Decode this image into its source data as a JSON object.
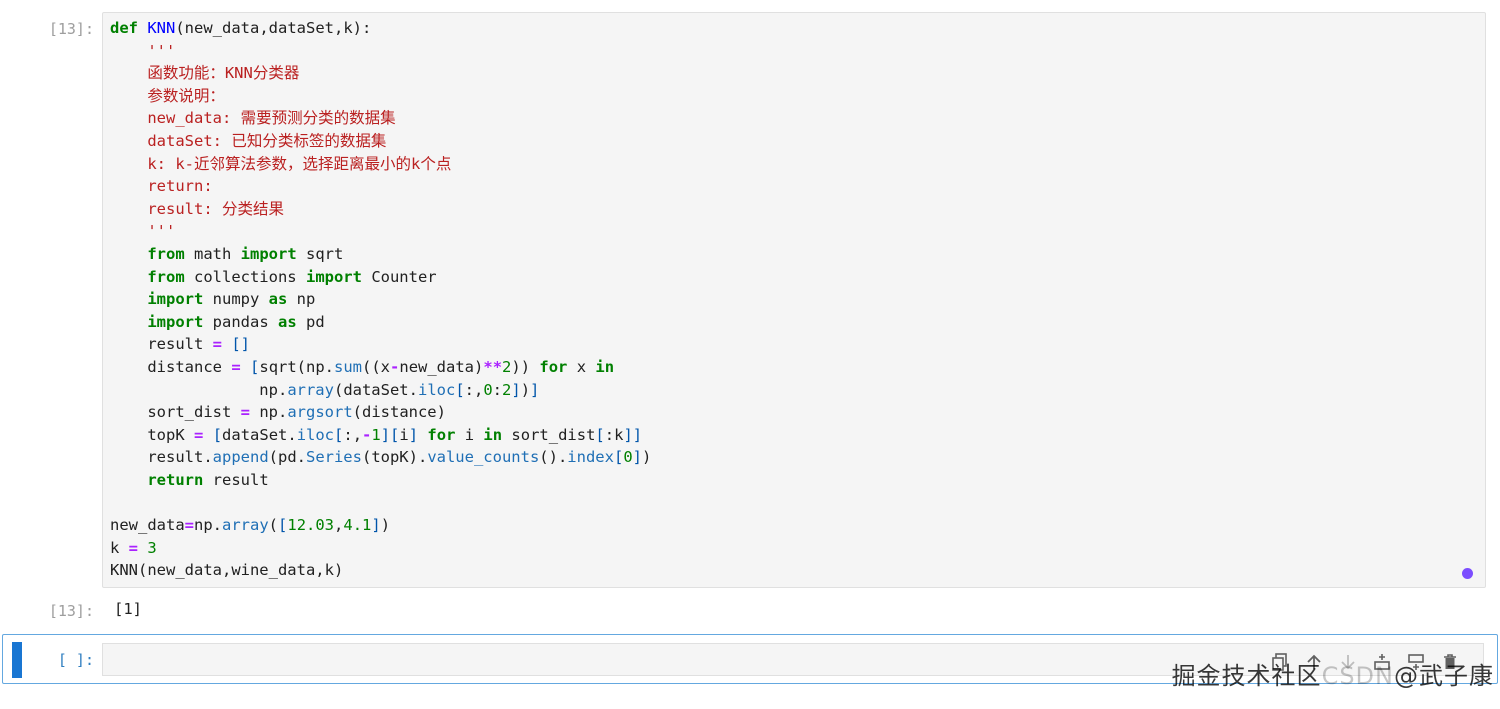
{
  "cells": [
    {
      "prompt": "[13]:",
      "code_lines": [
        [
          [
            "kw",
            "def"
          ],
          [
            "tx",
            " "
          ],
          [
            "fn",
            "KNN"
          ],
          [
            "tx",
            "(new_data,dataSet,k):"
          ]
        ],
        [
          [
            "tx",
            "    "
          ],
          [
            "st",
            "'''"
          ]
        ],
        [
          [
            "tx",
            "    "
          ],
          [
            "st",
            "函数功能：KNN分类器"
          ]
        ],
        [
          [
            "tx",
            "    "
          ],
          [
            "st",
            "参数说明："
          ]
        ],
        [
          [
            "tx",
            "    "
          ],
          [
            "st",
            "new_data: 需要预测分类的数据集"
          ]
        ],
        [
          [
            "tx",
            "    "
          ],
          [
            "st",
            "dataSet: 已知分类标签的数据集"
          ]
        ],
        [
          [
            "tx",
            "    "
          ],
          [
            "st",
            "k: k-近邻算法参数，选择距离最小的k个点"
          ]
        ],
        [
          [
            "tx",
            "    "
          ],
          [
            "st",
            "return:"
          ]
        ],
        [
          [
            "tx",
            "    "
          ],
          [
            "st",
            "result: 分类结果"
          ]
        ],
        [
          [
            "tx",
            "    "
          ],
          [
            "st",
            "'''"
          ]
        ],
        [
          [
            "tx",
            "    "
          ],
          [
            "kw",
            "from"
          ],
          [
            "tx",
            " math "
          ],
          [
            "kw",
            "import"
          ],
          [
            "tx",
            " sqrt"
          ]
        ],
        [
          [
            "tx",
            "    "
          ],
          [
            "kw",
            "from"
          ],
          [
            "tx",
            " collections "
          ],
          [
            "kw",
            "import"
          ],
          [
            "tx",
            " Counter"
          ]
        ],
        [
          [
            "tx",
            "    "
          ],
          [
            "kw",
            "import"
          ],
          [
            "tx",
            " numpy "
          ],
          [
            "kw",
            "as"
          ],
          [
            "tx",
            " np"
          ]
        ],
        [
          [
            "tx",
            "    "
          ],
          [
            "kw",
            "import"
          ],
          [
            "tx",
            " pandas "
          ],
          [
            "kw",
            "as"
          ],
          [
            "tx",
            " pd"
          ]
        ],
        [
          [
            "tx",
            "    result "
          ],
          [
            "op",
            "="
          ],
          [
            "tx",
            " "
          ],
          [
            "br",
            "[]"
          ]
        ],
        [
          [
            "tx",
            "    distance "
          ],
          [
            "op",
            "="
          ],
          [
            "tx",
            " "
          ],
          [
            "br",
            "["
          ],
          [
            "tx",
            "sqrt(np."
          ],
          [
            "at",
            "sum"
          ],
          [
            "tx",
            "((x"
          ],
          [
            "op",
            "-"
          ],
          [
            "tx",
            "new_data)"
          ],
          [
            "op",
            "**"
          ],
          [
            "nu",
            "2"
          ],
          [
            "tx",
            ")) "
          ],
          [
            "kw",
            "for"
          ],
          [
            "tx",
            " x "
          ],
          [
            "kw",
            "in"
          ]
        ],
        [
          [
            "tx",
            "                np."
          ],
          [
            "at",
            "array"
          ],
          [
            "tx",
            "(dataSet."
          ],
          [
            "at",
            "iloc"
          ],
          [
            "br",
            "["
          ],
          [
            "tx",
            ":,"
          ],
          [
            "nu",
            "0"
          ],
          [
            "tx",
            ":"
          ],
          [
            "nu",
            "2"
          ],
          [
            "br",
            "]"
          ],
          [
            "tx",
            ")"
          ],
          [
            "br",
            "]"
          ]
        ],
        [
          [
            "tx",
            "    sort_dist "
          ],
          [
            "op",
            "="
          ],
          [
            "tx",
            " np."
          ],
          [
            "at",
            "argsort"
          ],
          [
            "tx",
            "(distance)"
          ]
        ],
        [
          [
            "tx",
            "    topK "
          ],
          [
            "op",
            "="
          ],
          [
            "tx",
            " "
          ],
          [
            "br",
            "["
          ],
          [
            "tx",
            "dataSet."
          ],
          [
            "at",
            "iloc"
          ],
          [
            "br",
            "["
          ],
          [
            "tx",
            ":,"
          ],
          [
            "op",
            "-"
          ],
          [
            "nu",
            "1"
          ],
          [
            "br",
            "]["
          ],
          [
            "tx",
            "i"
          ],
          [
            "br",
            "]"
          ],
          [
            "tx",
            " "
          ],
          [
            "kw",
            "for"
          ],
          [
            "tx",
            " i "
          ],
          [
            "kw",
            "in"
          ],
          [
            "tx",
            " sort_dist"
          ],
          [
            "br",
            "["
          ],
          [
            "tx",
            ":k"
          ],
          [
            "br",
            "]]"
          ]
        ],
        [
          [
            "tx",
            "    result."
          ],
          [
            "at",
            "append"
          ],
          [
            "tx",
            "(pd."
          ],
          [
            "at",
            "Series"
          ],
          [
            "tx",
            "(topK)."
          ],
          [
            "at",
            "value_counts"
          ],
          [
            "tx",
            "()."
          ],
          [
            "at",
            "index"
          ],
          [
            "br",
            "["
          ],
          [
            "nu",
            "0"
          ],
          [
            "br",
            "]"
          ],
          [
            "tx",
            ")"
          ]
        ],
        [
          [
            "tx",
            "    "
          ],
          [
            "kw",
            "return"
          ],
          [
            "tx",
            " result"
          ]
        ],
        [
          [
            "tx",
            ""
          ]
        ],
        [
          [
            "tx",
            "new_data"
          ],
          [
            "op",
            "="
          ],
          [
            "tx",
            "np."
          ],
          [
            "at",
            "array"
          ],
          [
            "tx",
            "("
          ],
          [
            "br",
            "["
          ],
          [
            "nu",
            "12.03"
          ],
          [
            "tx",
            ","
          ],
          [
            "nu",
            "4.1"
          ],
          [
            "br",
            "]"
          ],
          [
            "tx",
            ")"
          ]
        ],
        [
          [
            "tx",
            "k "
          ],
          [
            "op",
            "="
          ],
          [
            "tx",
            " "
          ],
          [
            "nu",
            "3"
          ]
        ],
        [
          [
            "tx",
            "KNN(new_data,wine_data,k)"
          ]
        ]
      ],
      "output_prompt": "[13]:",
      "output_text": "[1]"
    },
    {
      "prompt": "[ ]:"
    }
  ],
  "toolbar": {
    "icons": [
      "copy-icon",
      "move-up-icon",
      "move-down-icon",
      "insert-above-icon",
      "insert-below-icon",
      "delete-icon"
    ]
  },
  "watermark": {
    "left": "掘金技术社区",
    "light": "CSDN",
    "right": "@武子康"
  },
  "colors": {
    "keyword": "#008000",
    "string": "#ba2121",
    "operator": "#aa22ff",
    "active_accent": "#1976d2",
    "status_dot": "#7c4dff"
  }
}
